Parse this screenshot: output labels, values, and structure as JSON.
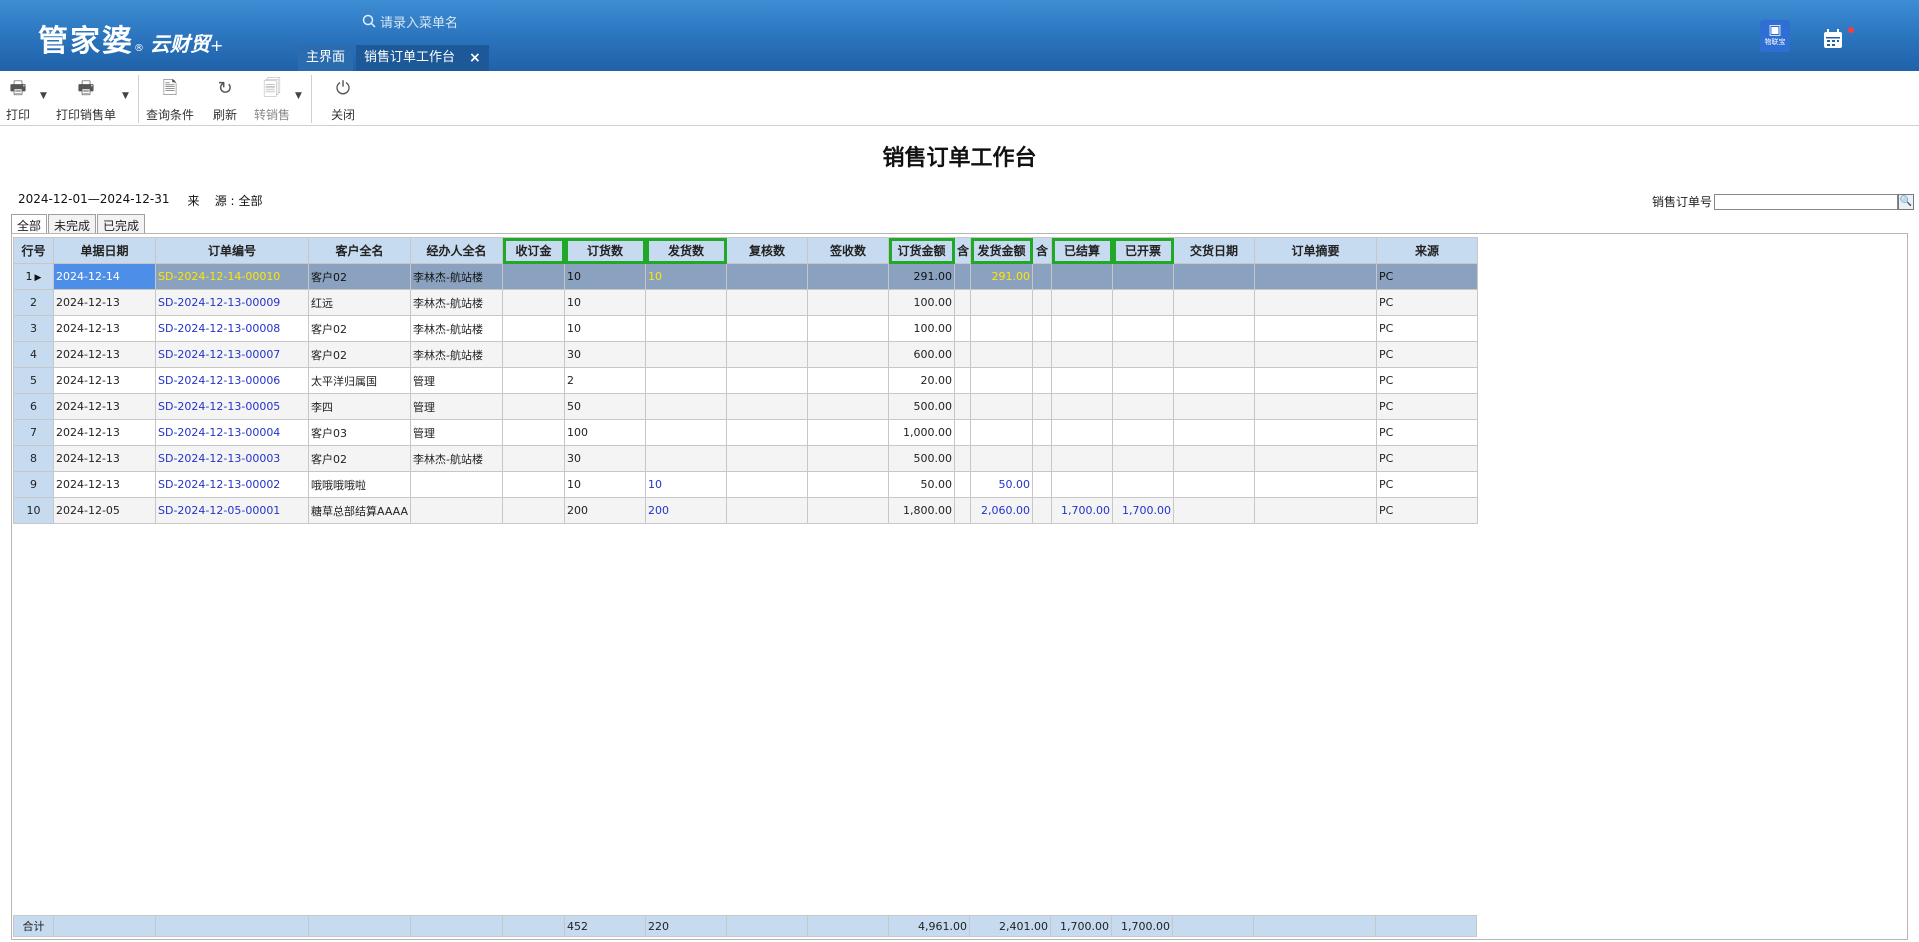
{
  "app": {
    "brand": "管家婆",
    "brand_sub": "云财贸",
    "plus": "+",
    "menu_search_placeholder": "请录入菜单名",
    "tabs": [
      {
        "label": "主界面"
      },
      {
        "label": "销售订单工作台",
        "close": "×"
      }
    ],
    "iot_label": "物联宝"
  },
  "toolbar": {
    "print": "打印",
    "print_sales": "打印销售单",
    "query": "查询条件",
    "refresh": "刷新",
    "transfer": "转销售",
    "close": "关闭"
  },
  "page": {
    "title": "销售订单工作台",
    "date_range": "2024-12-01—2024-12-31",
    "source_label": "来    源 :",
    "source_value": "全部",
    "order_no_label": "销售订单号",
    "order_no_value": "",
    "subtabs": [
      "全部",
      "未完成",
      "已完成"
    ]
  },
  "grid": {
    "columns": [
      "行号",
      "单据日期",
      "订单编号",
      "客户全名",
      "经办人全名",
      "收订金",
      "订货数",
      "发货数",
      "复核数",
      "签收数",
      "订货金额",
      "含",
      "发货金额",
      "含",
      "已结算",
      "已开票",
      "交货日期",
      "订单摘要",
      "来源"
    ],
    "rows": [
      {
        "no": "1",
        "date": "2024-12-14",
        "order": "SD-2024-12-14-00010",
        "customer": "客户02",
        "agent": "李林杰-航站楼",
        "qty": "10",
        "ship": "10",
        "amount": "291.00",
        "ship_amount": "291.00",
        "settled": "",
        "invoiced": "",
        "src": "PC"
      },
      {
        "no": "2",
        "date": "2024-12-13",
        "order": "SD-2024-12-13-00009",
        "customer": "红远",
        "agent": "李林杰-航站楼",
        "qty": "10",
        "ship": "",
        "amount": "100.00",
        "ship_amount": "",
        "settled": "",
        "invoiced": "",
        "src": "PC"
      },
      {
        "no": "3",
        "date": "2024-12-13",
        "order": "SD-2024-12-13-00008",
        "customer": "客户02",
        "agent": "李林杰-航站楼",
        "qty": "10",
        "ship": "",
        "amount": "100.00",
        "ship_amount": "",
        "settled": "",
        "invoiced": "",
        "src": "PC"
      },
      {
        "no": "4",
        "date": "2024-12-13",
        "order": "SD-2024-12-13-00007",
        "customer": "客户02",
        "agent": "李林杰-航站楼",
        "qty": "30",
        "ship": "",
        "amount": "600.00",
        "ship_amount": "",
        "settled": "",
        "invoiced": "",
        "src": "PC"
      },
      {
        "no": "5",
        "date": "2024-12-13",
        "order": "SD-2024-12-13-00006",
        "customer": "太平洋归属国",
        "agent": "管理",
        "qty": "2",
        "ship": "",
        "amount": "20.00",
        "ship_amount": "",
        "settled": "",
        "invoiced": "",
        "src": "PC"
      },
      {
        "no": "6",
        "date": "2024-12-13",
        "order": "SD-2024-12-13-00005",
        "customer": "李四",
        "agent": "管理",
        "qty": "50",
        "ship": "",
        "amount": "500.00",
        "ship_amount": "",
        "settled": "",
        "invoiced": "",
        "src": "PC"
      },
      {
        "no": "7",
        "date": "2024-12-13",
        "order": "SD-2024-12-13-00004",
        "customer": "客户03",
        "agent": "管理",
        "qty": "100",
        "ship": "",
        "amount": "1,000.00",
        "ship_amount": "",
        "settled": "",
        "invoiced": "",
        "src": "PC"
      },
      {
        "no": "8",
        "date": "2024-12-13",
        "order": "SD-2024-12-13-00003",
        "customer": "客户02",
        "agent": "李林杰-航站楼",
        "qty": "30",
        "ship": "",
        "amount": "500.00",
        "ship_amount": "",
        "settled": "",
        "invoiced": "",
        "src": "PC"
      },
      {
        "no": "9",
        "date": "2024-12-13",
        "order": "SD-2024-12-13-00002",
        "customer": "哦哦哦哦啦",
        "agent": "",
        "qty": "10",
        "ship": "10",
        "amount": "50.00",
        "ship_amount": "50.00",
        "settled": "",
        "invoiced": "",
        "src": "PC"
      },
      {
        "no": "10",
        "date": "2024-12-05",
        "order": "SD-2024-12-05-00001",
        "customer": "糖草总部结算AAAA",
        "agent": "",
        "qty": "200",
        "ship": "200",
        "amount": "1,800.00",
        "ship_amount": "2,060.00",
        "settled": "1,700.00",
        "invoiced": "1,700.00",
        "src": "PC"
      }
    ],
    "totals": {
      "label": "合计",
      "qty": "452",
      "ship": "220",
      "amount": "4,961.00",
      "ship_amount": "2,401.00",
      "settled": "1,700.00",
      "invoiced": "1,700.00"
    },
    "highlight_color": "#21a829",
    "selected_row_color": "#8aa2bf"
  }
}
